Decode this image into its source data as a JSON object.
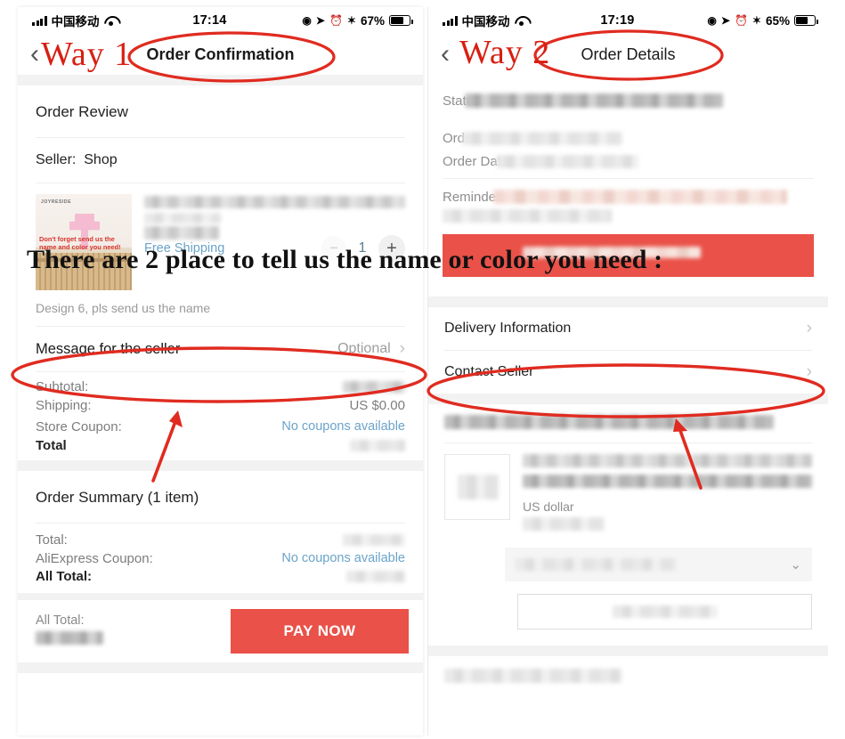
{
  "overlay": {
    "banner_text": "There are 2 place to tell us the name or color you need :",
    "way1_label": "Way 1",
    "way2_label": "Way 2",
    "accent_red": "#d81f12",
    "annotation_red": "#e02b20"
  },
  "left": {
    "status": {
      "carrier": "中国移动",
      "time": "17:14",
      "battery_percent": "67%",
      "icons": [
        "signal-bars-icon",
        "wifi-icon",
        "rotation-lock-icon",
        "location-arrow-icon",
        "alarm-clock-icon",
        "bluetooth-icon",
        "battery-icon"
      ]
    },
    "nav": {
      "back": "‹",
      "title": "Order Confirmation"
    },
    "order_review": {
      "title": "Order Review",
      "seller_label": "Seller:",
      "seller_name": "Shop",
      "product": {
        "thumb_brand": "JOYRESIDE",
        "thumb_note": "Don't forget send us the name and color you need!",
        "shipping": "Free Shipping",
        "variant": "Design 6, pls send us the name",
        "qty_minus": "−",
        "qty_value": "1",
        "qty_plus": "+"
      },
      "message_row": {
        "label": "Message for the seller",
        "value": "Optional",
        "chevron": "›"
      },
      "totals": [
        {
          "label": "Subtotal:",
          "value": "",
          "redacted": true
        },
        {
          "label": "Shipping:",
          "value": "US $0.00",
          "redacted": false
        },
        {
          "label": "Store Coupon:",
          "value": "No coupons available",
          "link": true
        },
        {
          "label": "Total",
          "value": "",
          "redacted": true,
          "bold": true
        }
      ]
    },
    "order_summary": {
      "title": "Order Summary (1 item)",
      "rows": [
        {
          "label": "Total:",
          "value": "",
          "redacted": true
        },
        {
          "label": "AliExpress Coupon:",
          "value": "No coupons available",
          "link": true
        },
        {
          "label": "All Total:",
          "value": "",
          "redacted": true,
          "bold": true
        }
      ]
    },
    "paybar": {
      "total_label": "All Total:",
      "pay_button": "PAY NOW"
    }
  },
  "right": {
    "status": {
      "carrier": "中国移动",
      "time": "17:19",
      "battery_percent": "65%"
    },
    "nav": {
      "back": "‹",
      "title": "Order Details"
    },
    "details": [
      {
        "label": "Status:",
        "redacted": true
      },
      {
        "label": "Order",
        "redacted": true
      },
      {
        "label": "Order Date:",
        "redacted": true
      },
      {
        "label": "Reminder:",
        "redacted": true,
        "tone": "pink"
      }
    ],
    "links": [
      {
        "label": "Delivery Information",
        "chevron": "›"
      },
      {
        "label": "Contact Seller",
        "chevron": "›"
      }
    ],
    "item": {
      "currency_note": "US dollar"
    }
  }
}
